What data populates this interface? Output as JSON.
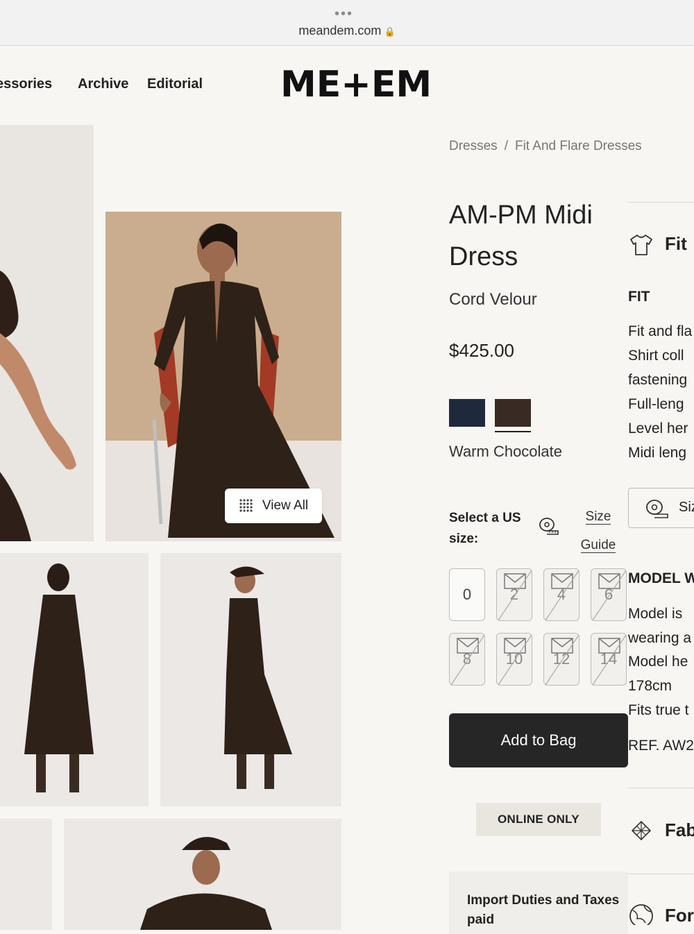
{
  "browser": {
    "url": "meandem.com"
  },
  "nav": {
    "items": [
      "essories",
      "Archive",
      "Editorial"
    ],
    "logo": "ME+EM"
  },
  "gallery": {
    "view_all": "View All"
  },
  "breadcrumb": {
    "items": [
      "Dresses",
      "Fit And Flare Dresses"
    ],
    "separator": "/"
  },
  "product": {
    "title": "AM-PM Midi Dress",
    "fabric": "Cord Velour",
    "price": "$425.00",
    "colors": [
      {
        "name": "Navy",
        "hex": "#1e2a3c",
        "selected": false
      },
      {
        "name": "Warm Chocolate",
        "hex": "#3a2a24",
        "selected": true
      }
    ],
    "selected_color": "Warm Chocolate"
  },
  "size": {
    "label": "Select a US size:",
    "guide": "Size Guide",
    "options": [
      {
        "value": "0",
        "available": true
      },
      {
        "value": "2",
        "available": false
      },
      {
        "value": "4",
        "available": false
      },
      {
        "value": "6",
        "available": false
      },
      {
        "value": "8",
        "available": false
      },
      {
        "value": "10",
        "available": false
      },
      {
        "value": "12",
        "available": false
      },
      {
        "value": "14",
        "available": false
      }
    ]
  },
  "actions": {
    "add_to_bag": "Add to Bag",
    "online_only": "ONLINE ONLY",
    "duties": "Import Duties and Taxes paid"
  },
  "details": {
    "fit_heading": "Fit",
    "fit_sub": "FIT",
    "fit_lines": [
      "Fit and fla",
      "Shirt coll",
      "fastening",
      "Full-leng",
      "Level her",
      "Midi leng"
    ],
    "size_box": "Siz",
    "model_heading": "MODEL W",
    "model_lines": [
      "Model is",
      "wearing a",
      "Model he",
      "178cm",
      "Fits true t"
    ],
    "ref": "REF. AW2",
    "fabric_heading": "Fab",
    "for_heading": "For"
  }
}
